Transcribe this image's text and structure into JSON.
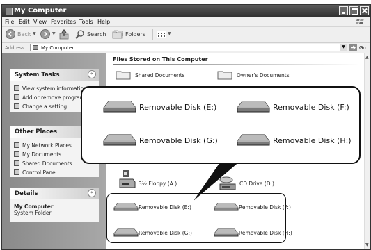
{
  "window": {
    "title": "My Computer",
    "controls": [
      "minimize-icon",
      "maximize-icon",
      "close-icon"
    ]
  },
  "menu": {
    "items": [
      {
        "label": "File"
      },
      {
        "label": "Edit"
      },
      {
        "label": "View"
      },
      {
        "label": "Favorites"
      },
      {
        "label": "Tools"
      },
      {
        "label": "Help"
      }
    ]
  },
  "toolbar": {
    "back_label": "Back",
    "search_label": "Search",
    "folders_label": "Folders"
  },
  "address": {
    "label": "Address",
    "value": "My Computer",
    "go_label": "Go"
  },
  "sidebar": {
    "system_tasks": {
      "title": "System Tasks",
      "items": [
        {
          "label": "View system information",
          "icon": "info-icon"
        },
        {
          "label": "Add or remove programs",
          "icon": "programs-icon"
        },
        {
          "label": "Change a setting",
          "icon": "control-icon"
        }
      ]
    },
    "other_places": {
      "title": "Other Places",
      "items": [
        {
          "label": "My Network Places",
          "icon": "network-icon"
        },
        {
          "label": "My Documents",
          "icon": "folder-icon"
        },
        {
          "label": "Shared Documents",
          "icon": "folder-icon"
        },
        {
          "label": "Control Panel",
          "icon": "control-icon"
        }
      ]
    },
    "details": {
      "title": "Details",
      "name": "My Computer",
      "type": "System Folder"
    }
  },
  "content": {
    "section_title": "Files Stored on This Computer",
    "partial_items": [
      "Shared Documents",
      "Owner's Documents"
    ],
    "drives": [
      {
        "label": "3½ Floppy (A:)",
        "icon": "floppy-icon"
      },
      {
        "label": "CD Drive (D:)",
        "icon": "cd-drive-icon"
      },
      {
        "label": "Removable Disk (E:)",
        "icon": "removable-disk-icon"
      },
      {
        "label": "Removable Disk (F:)",
        "icon": "removable-disk-icon"
      },
      {
        "label": "Removable Disk (G:)",
        "icon": "removable-disk-icon"
      },
      {
        "label": "Removable Disk (H:)",
        "icon": "removable-disk-icon"
      }
    ]
  },
  "callout": {
    "items": [
      {
        "label": "Removable Disk (E:)"
      },
      {
        "label": "Removable Disk (F:)"
      },
      {
        "label": "Removable Disk (G:)"
      },
      {
        "label": "Removable Disk (H:)"
      }
    ]
  }
}
